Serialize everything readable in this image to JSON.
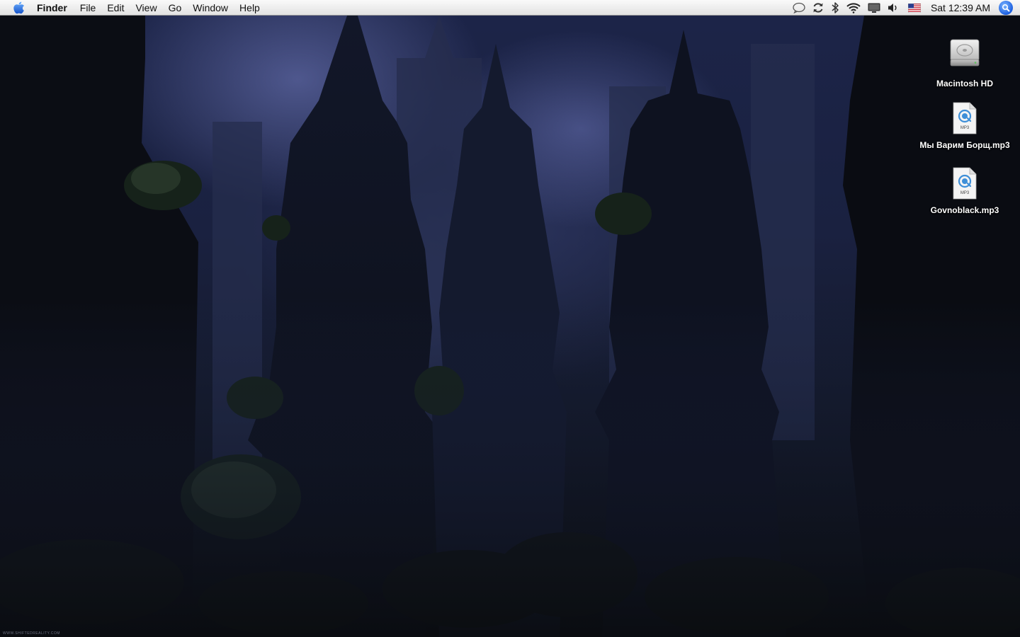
{
  "menubar": {
    "app_name": "Finder",
    "menus": [
      "File",
      "Edit",
      "View",
      "Go",
      "Window",
      "Help"
    ],
    "clock": "Sat 12:39 AM",
    "status_icons": [
      "speech-bubble-icon",
      "sync-icon",
      "bluetooth-icon",
      "wifi-icon",
      "display-icon",
      "volume-icon",
      "us-flag-input-icon"
    ]
  },
  "desktop": {
    "icons": [
      {
        "label": "Macintosh HD",
        "icon": "hard-drive-icon"
      },
      {
        "label": "Мы Варим Борщ.mp3",
        "icon": "mp3-file-icon"
      },
      {
        "label": "Govnoblack.mp3",
        "icon": "mp3-file-icon"
      }
    ],
    "mp3_badge": "MP3",
    "watermark": "WWW.SHIFTEDREALITY.COM"
  }
}
